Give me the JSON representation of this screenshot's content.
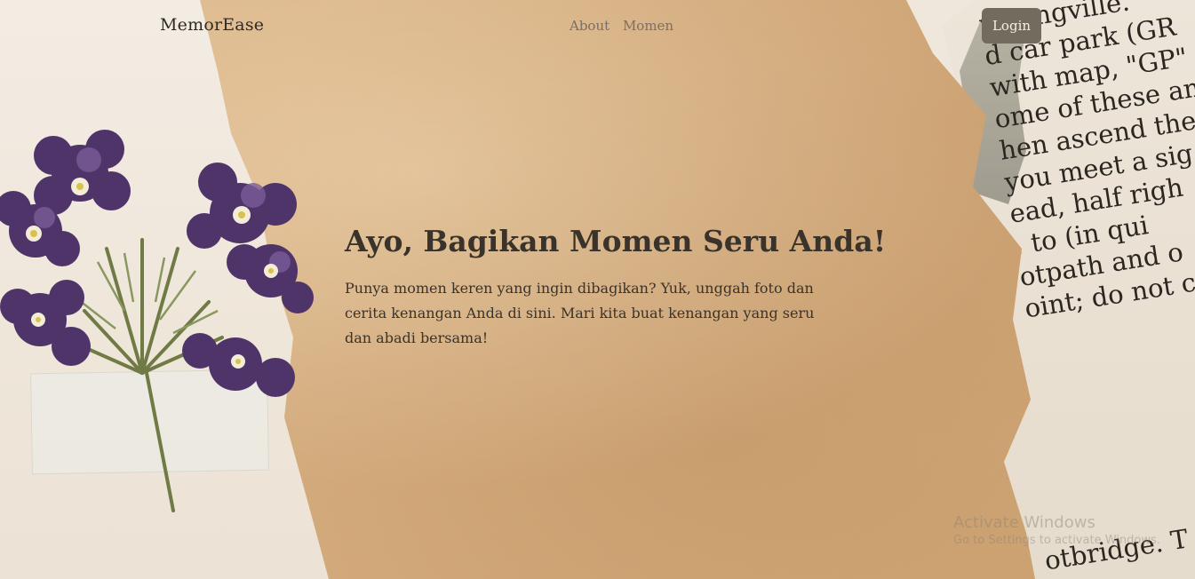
{
  "nav": {
    "brand": "MemorEase",
    "links": [
      "About",
      "Momen"
    ],
    "login_label": "Login"
  },
  "hero": {
    "title": "Ayo, Bagikan Momen Seru Anda!",
    "body": "Punya momen keren yang ingin dibagikan? Yuk, unggah foto dan cerita kenangan Anda di sini. Mari kita buat kenangan yang seru dan abadi bersama!"
  },
  "background_book_text": [
    "y Longville.",
    "d car park (GR",
    "with  map,  \"GP\"",
    "ome of these and",
    "hen ascend the",
    "you meet a sig",
    "ead, half righ",
    ", to  (in  qui",
    "otpath  and  o",
    "oint; do not cr"
  ],
  "background_book_bottom": "otbridge. T",
  "watermark": {
    "line1": "Activate Windows",
    "line2": "Go to Settings to activate Windows."
  },
  "colors": {
    "kraft": "#d6ae80",
    "login_bg": "#736c5e",
    "text_dark": "#3a332b",
    "nav_link": "#7a6f63",
    "flower_purple": "#4e3468"
  }
}
